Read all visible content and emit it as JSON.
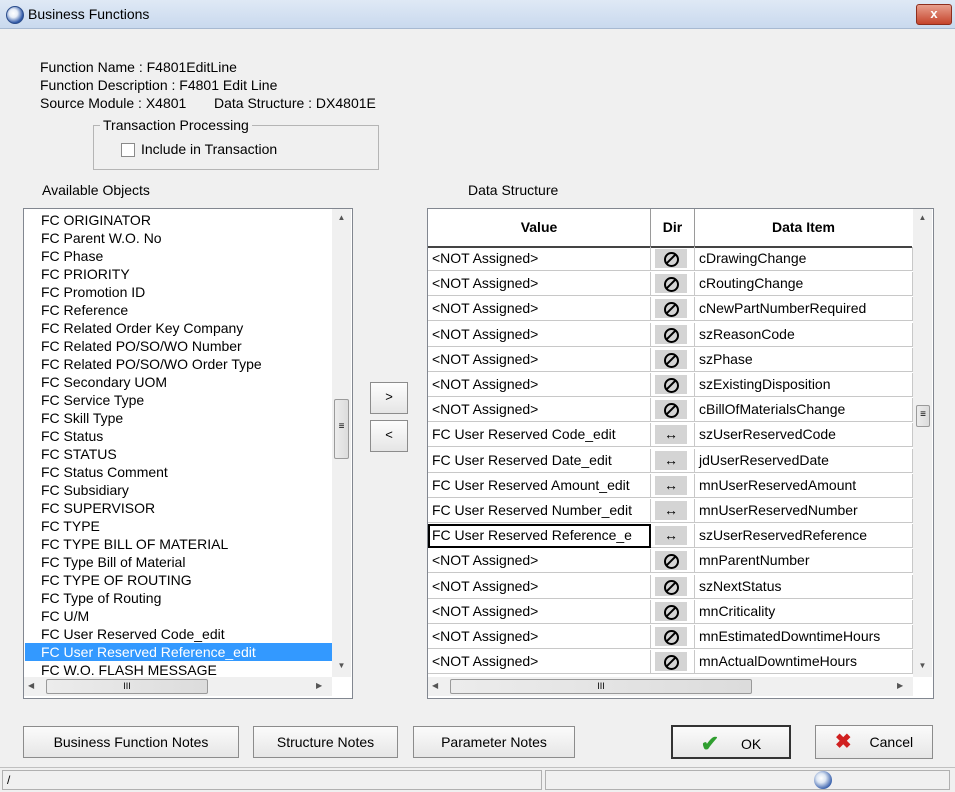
{
  "window": {
    "title": "Business Functions",
    "close_label": "x"
  },
  "info": {
    "function_name": "Function Name : F4801EditLine",
    "function_description": "Function Description : F4801 Edit Line",
    "source_module": "Source Module : X4801",
    "data_structure": "Data Structure : DX4801E"
  },
  "transaction": {
    "legend": "Transaction Processing",
    "checkbox_label": "Include in Transaction",
    "checked": false
  },
  "available": {
    "label": "Available Objects",
    "items": [
      "FC  ORIGINATOR",
      "FC  Parent W.O. No",
      "FC  Phase",
      "FC  PRIORITY",
      "FC  Promotion ID",
      "FC  Reference",
      "FC  Related Order Key Company",
      "FC  Related PO/SO/WO Number",
      "FC  Related PO/SO/WO Order Type",
      "FC  Secondary UOM",
      "FC  Service Type",
      "FC  Skill Type",
      "FC  Status",
      "FC  STATUS",
      "FC  Status Comment",
      "FC  Subsidiary",
      "FC  SUPERVISOR",
      "FC  TYPE",
      "FC  TYPE BILL OF MATERIAL",
      "FC  Type Bill of Material",
      "FC  TYPE OF ROUTING",
      "FC  Type of Routing",
      "FC  U/M",
      "FC  User Reserved Code_edit",
      "FC  User Reserved Reference_edit",
      "FC  W.O. FLASH MESSAGE"
    ],
    "selected_index": 24
  },
  "move": {
    "add": ">",
    "remove": "<"
  },
  "structure": {
    "label": "Data Structure",
    "headers": {
      "value": "Value",
      "dir": "Dir",
      "item": "Data Item"
    },
    "rows": [
      {
        "value": "<NOT Assigned>",
        "dir": "none",
        "item": "cDrawingChange"
      },
      {
        "value": "<NOT Assigned>",
        "dir": "none",
        "item": "cRoutingChange"
      },
      {
        "value": "<NOT Assigned>",
        "dir": "none",
        "item": "cNewPartNumberRequired"
      },
      {
        "value": "<NOT Assigned>",
        "dir": "none",
        "item": "szReasonCode"
      },
      {
        "value": "<NOT Assigned>",
        "dir": "none",
        "item": "szPhase"
      },
      {
        "value": "<NOT Assigned>",
        "dir": "none",
        "item": "szExistingDisposition"
      },
      {
        "value": "<NOT Assigned>",
        "dir": "none",
        "item": "cBillOfMaterialsChange"
      },
      {
        "value": "FC User Reserved Code_edit",
        "dir": "both",
        "item": "szUserReservedCode"
      },
      {
        "value": "FC User Reserved Date_edit",
        "dir": "both",
        "item": "jdUserReservedDate"
      },
      {
        "value": "FC User Reserved Amount_edit",
        "dir": "both",
        "item": "mnUserReservedAmount"
      },
      {
        "value": "FC User Reserved Number_edit",
        "dir": "both",
        "item": "mnUserReservedNumber"
      },
      {
        "value": "FC User Reserved Reference_e",
        "dir": "both",
        "item": "szUserReservedReference",
        "editing": true
      },
      {
        "value": "<NOT Assigned>",
        "dir": "none",
        "item": "mnParentNumber"
      },
      {
        "value": "<NOT Assigned>",
        "dir": "none",
        "item": "szNextStatus"
      },
      {
        "value": "<NOT Assigned>",
        "dir": "none",
        "item": "mnCriticality"
      },
      {
        "value": "<NOT Assigned>",
        "dir": "none",
        "item": "mnEstimatedDowntimeHours"
      },
      {
        "value": "<NOT Assigned>",
        "dir": "none",
        "item": "mnActualDowntimeHours"
      }
    ]
  },
  "buttons": {
    "bf_notes": "Business Function Notes",
    "structure_notes": "Structure Notes",
    "parameter_notes": "Parameter Notes",
    "ok": "OK",
    "cancel": "Cancel"
  },
  "status": {
    "text": "/"
  },
  "colors": {
    "selection": "#3399ff",
    "ok_check": "#2f9e2f",
    "cancel_x": "#d02020"
  }
}
